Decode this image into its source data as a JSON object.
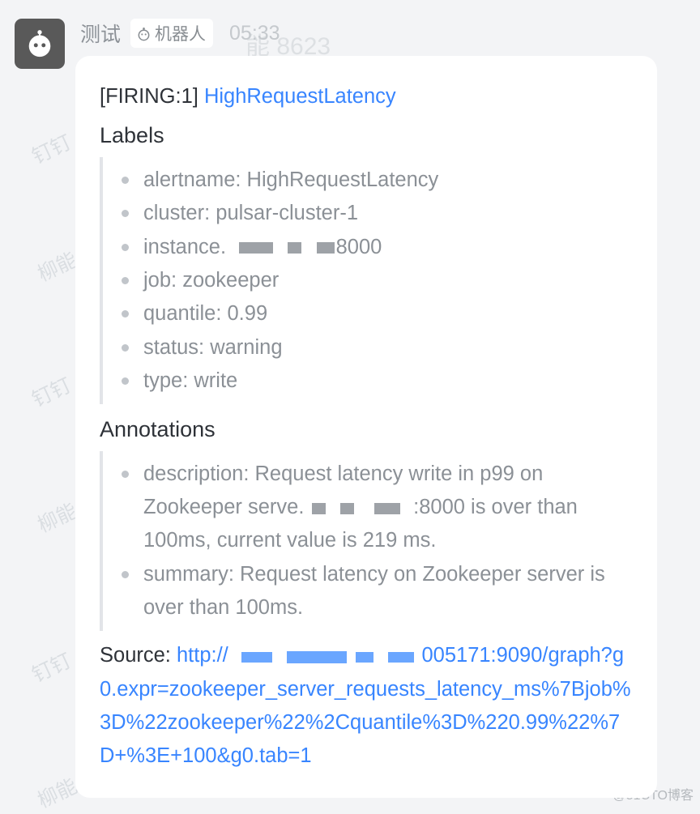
{
  "watermarks": {
    "a": "钉钉",
    "b": "柳能"
  },
  "credit": "@51CTO博客",
  "bg_smudge": "能 8623",
  "sender": {
    "name": "测试",
    "bot_label": "机器人",
    "time": "05:33"
  },
  "alert": {
    "firing_prefix": "[FIRING:1] ",
    "title_link": "HighRequestLatency",
    "labels_heading": "Labels",
    "labels": {
      "alertname": "alertname: HighRequestLatency",
      "cluster": "cluster: pulsar-cluster-1",
      "instance_pre": "instance. ",
      "instance_post": "8000",
      "job": "job: zookeeper",
      "quantile": "quantile: 0.99",
      "status": "status: warning",
      "type": "type: write"
    },
    "annotations_heading": "Annotations",
    "annotations": {
      "description_pre": "description: Request latency write in p99 on Zookeeper serve. ",
      "description_post": ":8000 is over than 100ms, current value is 219 ms.",
      "summary": "summary: Request latency on Zookeeper server is over than 100ms."
    },
    "source_label": "Source: ",
    "source_url_1": "http://",
    "source_url_2": "005171:9090/graph?g0.expr=zookeeper_server_requests_latency_ms%7Bjob%3D%22zookeeper%22%2Cquantile%3D%220.99%22%7D+%3E+100&g0.tab=1"
  }
}
